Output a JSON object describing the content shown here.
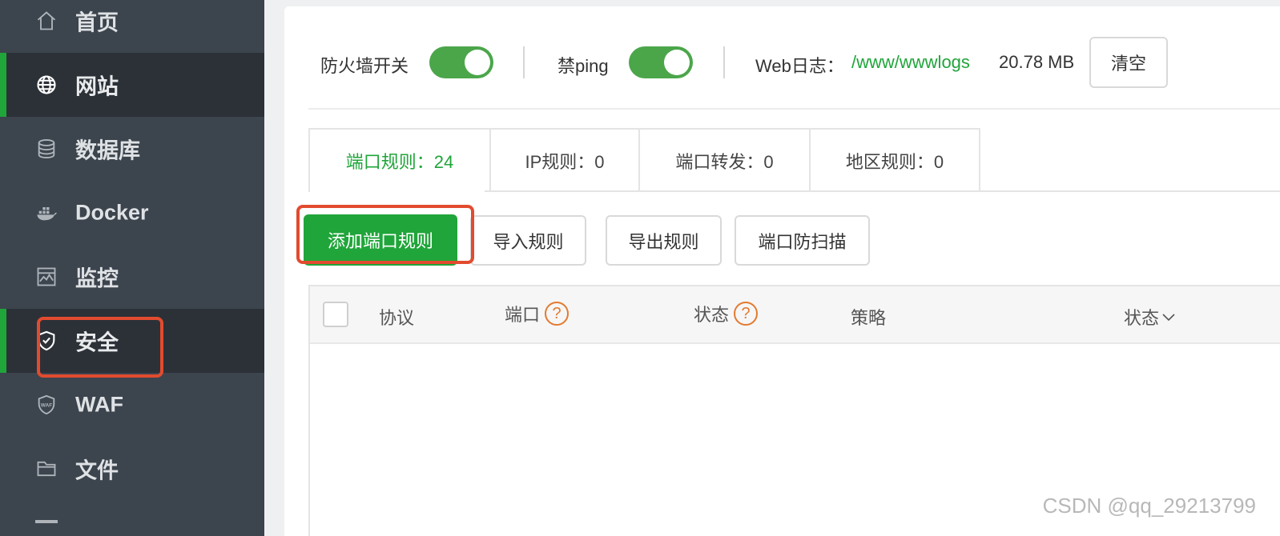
{
  "sidebar": {
    "items": [
      {
        "label": "首页",
        "icon": "home-icon"
      },
      {
        "label": "网站",
        "icon": "globe-icon"
      },
      {
        "label": "数据库",
        "icon": "database-icon"
      },
      {
        "label": "Docker",
        "icon": "docker-icon"
      },
      {
        "label": "监控",
        "icon": "monitor-icon"
      },
      {
        "label": "安全",
        "icon": "shield-icon"
      },
      {
        "label": "WAF",
        "icon": "waf-shield-icon"
      },
      {
        "label": "文件",
        "icon": "folder-icon"
      }
    ]
  },
  "topbar": {
    "firewall_label": "防火墙开关",
    "ping_label": "禁ping",
    "weblog_label": "Web日志：",
    "weblog_path": "/www/wwwlogs",
    "weblog_size": "20.78 MB",
    "clear_label": "清空"
  },
  "tabs": [
    {
      "label": "端口规则：24"
    },
    {
      "label": "IP规则：0"
    },
    {
      "label": "端口转发：0"
    },
    {
      "label": "地区规则：0"
    }
  ],
  "actions": {
    "add_port_rule": "添加端口规则",
    "import_rules": "导入规则",
    "export_rules": "导出规则",
    "port_anti_scan": "端口防扫描"
  },
  "table": {
    "headers": {
      "protocol": "协议",
      "port": "端口",
      "status": "状态",
      "policy": "策略",
      "status_sort": "状态"
    }
  },
  "watermark": "CSDN @qq_29213799",
  "colors": {
    "brand_green": "#20a53a",
    "sidebar_bg": "#3c444d",
    "highlight_red": "#e24b2f",
    "help_orange": "#e37a2f"
  }
}
